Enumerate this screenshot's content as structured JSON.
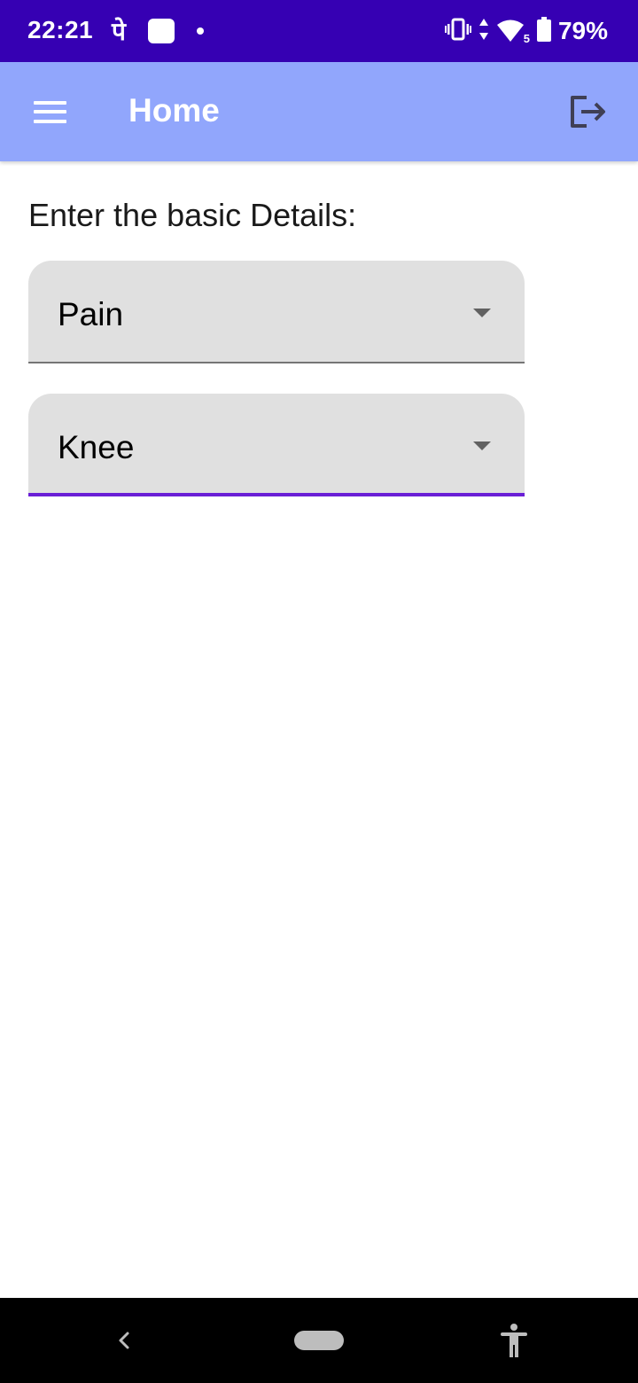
{
  "status_bar": {
    "time": "22:21",
    "pe_glyph": "पे",
    "battery_percent": "79%",
    "network_badge": "5",
    "icons": [
      "app-square-icon",
      "dot-icon",
      "vibrate-icon",
      "data-arrows-icon",
      "wifi-icon",
      "battery-icon"
    ],
    "background_color": "#3600b3"
  },
  "app_bar": {
    "title": "Home",
    "menu_icon": "hamburger-menu-icon",
    "logout_icon": "logout-icon",
    "background_color": "#91a6fc"
  },
  "main": {
    "heading": "Enter the basic Details:",
    "dropdowns": [
      {
        "selected": "Pain",
        "focused": false
      },
      {
        "selected": "Knee",
        "focused": true
      }
    ],
    "accent_color": "#6a1fd6"
  },
  "nav_bar": {
    "icons": [
      "back-icon",
      "home-pill-icon",
      "accessibility-icon"
    ]
  }
}
